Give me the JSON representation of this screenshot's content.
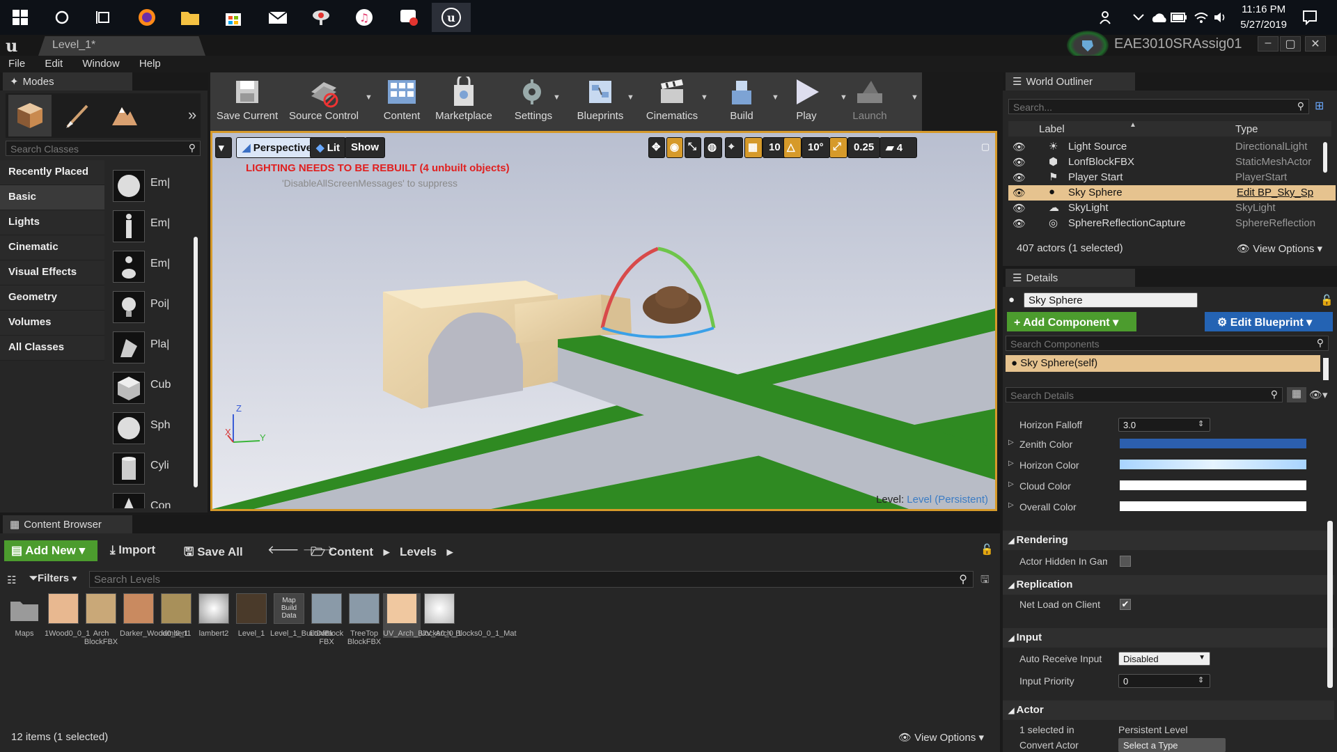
{
  "taskbar": {
    "clock_time": "11:16 PM",
    "clock_date": "5/27/2019"
  },
  "titlebar": {
    "tab_label": "Level_1*",
    "project_name": "EAE3010SRAssig01"
  },
  "menu": [
    "File",
    "Edit",
    "Window",
    "Help"
  ],
  "modes": {
    "tab_label": "Modes",
    "search_placeholder": "Search Classes",
    "categories": [
      "Recently Placed",
      "Basic",
      "Lights",
      "Cinematic",
      "Visual Effects",
      "Geometry",
      "Volumes",
      "All Classes"
    ],
    "selected_category": "Basic",
    "items": [
      "Em|",
      "Em|",
      "Em|",
      "Poi|",
      "Pla|",
      "Cub",
      "Sph",
      "Cyli",
      "Con"
    ]
  },
  "toolbar": {
    "buttons": [
      "Save Current",
      "Source Control",
      "Content",
      "Marketplace",
      "Settings",
      "Blueprints",
      "Cinematics",
      "Build",
      "Play",
      "Launch"
    ]
  },
  "viewport": {
    "perspective_label": "Perspective",
    "lit_label": "Lit",
    "show_label": "Show",
    "grid_snap": "10",
    "rot_snap": "10°",
    "scale_snap": "0.25",
    "cam_speed": "4",
    "warning": "LIGHTING NEEDS TO BE REBUILT (4 unbuilt objects)",
    "suppress_msg": "'DisableAllScreenMessages' to suppress",
    "level_label": "Level:",
    "level_name": "Level (Persistent)",
    "axis_z": "Z",
    "axis_x": "X",
    "axis_y": "Y"
  },
  "outliner": {
    "tab_label": "World Outliner",
    "search_placeholder": "Search...",
    "col_label": "Label",
    "col_type": "Type",
    "rows": [
      {
        "label": "Light Source",
        "type": "DirectionalLight"
      },
      {
        "label": "LonfBlockFBX",
        "type": "StaticMeshActor"
      },
      {
        "label": "Player Start",
        "type": "PlayerStart"
      },
      {
        "label": "Sky Sphere",
        "type": "Edit BP_Sky_Sp"
      },
      {
        "label": "SkyLight",
        "type": "SkyLight"
      },
      {
        "label": "SphereReflectionCapture",
        "type": "SphereReflection"
      }
    ],
    "status": "407 actors (1 selected)",
    "view_options": "View Options"
  },
  "details": {
    "tab_label": "Details",
    "actor_name": "Sky Sphere",
    "add_component": "Add Component",
    "edit_blueprint": "Edit Blueprint",
    "search_components": "Search Components",
    "component_self": "Sky Sphere(self)",
    "search_details": "Search Details",
    "horizon_falloff_label": "Horizon Falloff",
    "horizon_falloff_value": "3.0",
    "zenith_color_label": "Zenith Color",
    "horizon_color_label": "Horizon Color",
    "cloud_color_label": "Cloud Color",
    "overall_color_label": "Overall Color",
    "rendering_header": "Rendering",
    "actor_hidden_label": "Actor Hidden In Game",
    "replication_header": "Replication",
    "net_load_label": "Net Load on Client",
    "input_header": "Input",
    "auto_receive_label": "Auto Receive Input",
    "auto_receive_value": "Disabled",
    "input_priority_label": "Input Priority",
    "input_priority_value": "0",
    "actor_header": "Actor",
    "selected_in_label": "1 selected in",
    "selected_in_value": "Persistent Level",
    "convert_actor_label": "Convert Actor",
    "convert_actor_value": "Select a Type",
    "colors": {
      "zenith": "#2c5fae",
      "horizon": "#cfe8ff",
      "cloud": "#ffffff",
      "overall": "#ffffff"
    }
  },
  "content_browser": {
    "tab_label": "Content Browser",
    "add_new": "Add New",
    "import": "Import",
    "save_all": "Save All",
    "path_content": "Content",
    "path_levels": "Levels",
    "filters": "Filters",
    "search_placeholder": "Search Levels",
    "assets": [
      "Maps",
      "1Wood0_0_1",
      "Arch BlockFBX",
      "Darker_Wood0_0_1",
      "lambert1",
      "lambert2",
      "Level_1",
      "Level_1_BuiltData",
      "LonfBlock FBX",
      "TreeTop BlockFBX",
      "UV_Arch_Blocks0_0_1",
      "UV_Arch_Blocks0_0_1_Mat"
    ],
    "map_build_thumb": "Map Build Data",
    "status": "12 items (1 selected)",
    "view_options": "View Options"
  }
}
